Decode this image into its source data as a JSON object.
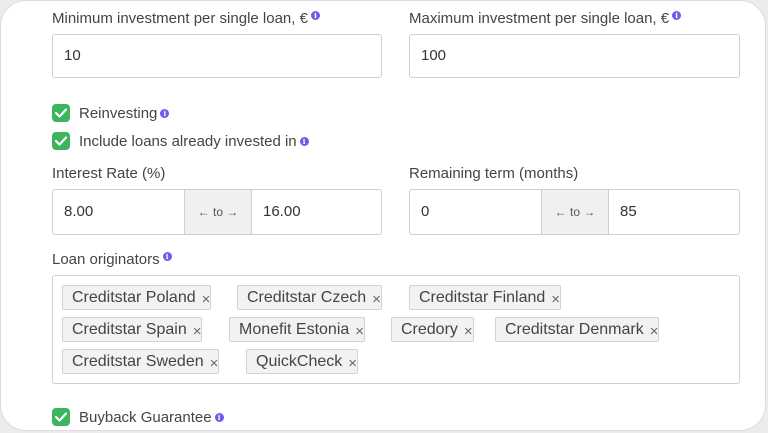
{
  "min_investment": {
    "label": "Minimum investment per single loan, €",
    "value": "10"
  },
  "max_investment": {
    "label": "Maximum investment per single loan, €",
    "value": "100"
  },
  "info_glyph": "i",
  "reinvesting": {
    "label": "Reinvesting",
    "checked": true
  },
  "include_invested": {
    "label": "Include loans already invested in",
    "checked": true
  },
  "interest_rate": {
    "label": "Interest Rate (%)",
    "from": "8.00",
    "separator": "← to →",
    "to": "16.00"
  },
  "remaining_term": {
    "label": "Remaining term (months)",
    "from": "0",
    "separator": "← to →",
    "to": "85"
  },
  "loan_originators": {
    "label": "Loan originators",
    "remove_glyph": "×",
    "tags": [
      "Creditstar Poland",
      "Creditstar Czech",
      "Creditstar Finland",
      "Creditstar Spain",
      "Monefit Estonia",
      "Credory",
      "Creditstar Denmark",
      "Creditstar Sweden",
      "QuickCheck"
    ]
  },
  "buyback": {
    "label": "Buyback Guarantee",
    "checked": true
  },
  "colors": {
    "accent_green": "#3db45e",
    "info_purple": "#6c5ce7"
  },
  "icons": {
    "info": "info-icon",
    "check": "check-icon",
    "remove": "close-icon"
  }
}
